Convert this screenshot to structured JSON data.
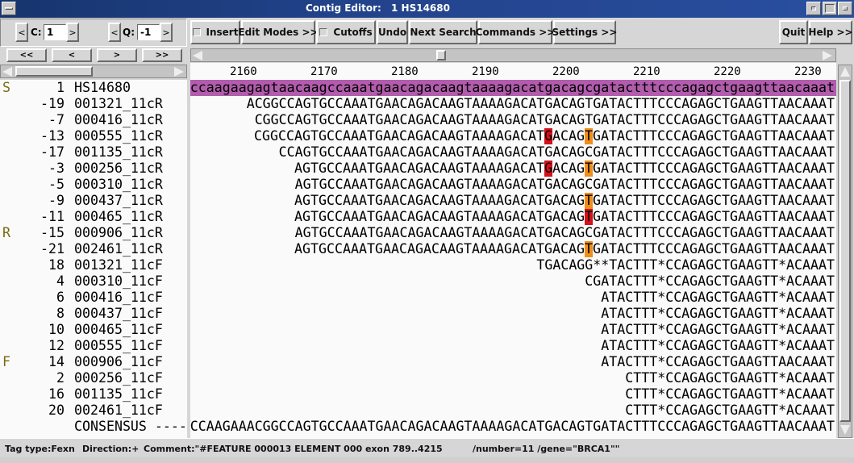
{
  "window": {
    "title": "Contig Editor:",
    "contig": "1 HS14680"
  },
  "toolbar": {
    "c_label": "C:",
    "c_value": "1",
    "q_label": "Q:",
    "q_value": "-1",
    "insert_label": "Insert",
    "edit_modes_label": "Edit Modes >>",
    "cutoffs_label": "Cutoffs",
    "undo_label": "Undo",
    "next_search_label": "Next Search",
    "commands_label": "Commands >>",
    "settings_label": "Settings >>",
    "quit_label": "Quit",
    "help_label": "Help >>",
    "left_arrow": "<",
    "right_arrow": ">"
  },
  "nav": {
    "first": "<<",
    "prev": "<",
    "next": ">",
    "last": ">>"
  },
  "ruler": {
    "ticks": [
      "2160",
      "2170",
      "2180",
      "2190",
      "2200",
      "2210",
      "2220",
      "2230"
    ]
  },
  "rows": [
    {
      "flag": "S",
      "num": "1",
      "name": "HS14680",
      "seq": "ccaagaagagtaacaagccaaatgaacagacaagtaaaagacatgacagcgatactttcccagagctgaagttaacaaat",
      "ref": true,
      "hl": []
    },
    {
      "flag": "",
      "num": "-19",
      "name": "001321_11cR",
      "seq": "ACGGCCAGTGCCAAATGAACAGACAAGTAAAAGACATGACAGTGATACTTTCCCAGAGCTGAAGTTAACAAAT",
      "hl": []
    },
    {
      "flag": "",
      "num": "-7",
      "name": "000416_11cR",
      "seq": "CGGCCAGTGCCAAATGAACAGACAAGTAAAAGACATGACAGTGATACTTTCCCAGAGCTGAAGTTAACAAAT",
      "hl": []
    },
    {
      "flag": "",
      "num": "-13",
      "name": "000555_11cR",
      "seq": "CGGCCAGTGCCAAATGAACAGACAAGTAAAAGACATGACAGTGATACTTTCCCAGAGCTGAAGTTAACAAAT",
      "hl": [
        {
          "from_end": 36,
          "color": "r"
        },
        {
          "from_end": 31,
          "color": "o"
        }
      ]
    },
    {
      "flag": "",
      "num": "-17",
      "name": "001135_11cR",
      "seq": "CCAGTGCCAAATGAACAGACAAGTAAAAGACATGACAGCGATACTTTCCCAGAGCTGAAGTTAACAAAT",
      "hl": []
    },
    {
      "flag": "",
      "num": "-3",
      "name": "000256_11cR",
      "seq": "AGTGCCAAATGAACAGACAAGTAAAAGACATGACAGTGATACTTTCCCAGAGCTGAAGTTAACAAAT",
      "hl": [
        {
          "from_end": 36,
          "color": "r"
        },
        {
          "from_end": 31,
          "color": "o"
        }
      ]
    },
    {
      "flag": "",
      "num": "-5",
      "name": "000310_11cR",
      "seq": "AGTGCCAAATGAACAGACAAGTAAAAGACATGACAGCGATACTTTCCCAGAGCTGAAGTTAACAAAT",
      "hl": []
    },
    {
      "flag": "",
      "num": "-9",
      "name": "000437_11cR",
      "seq": "AGTGCCAAATGAACAGACAAGTAAAAGACATGACAGTGATACTTTCCCAGAGCTGAAGTTAACAAAT",
      "hl": [
        {
          "from_end": 31,
          "color": "o"
        }
      ]
    },
    {
      "flag": "",
      "num": "-11",
      "name": "000465_11cR",
      "seq": "AGTGCCAAATGAACAGACAAGTAAAAGACATGACAGTGATACTTTCCCAGAGCTGAAGTTAACAAAT",
      "hl": [
        {
          "from_end": 31,
          "color": "r"
        }
      ]
    },
    {
      "flag": "R",
      "num": "-15",
      "name": "000906_11cR",
      "seq": "AGTGCCAAATGAACAGACAAGTAAAAGACATGACAGCGATACTTTCCCAGAGCTGAAGTTAACAAAT",
      "hl": []
    },
    {
      "flag": "",
      "num": "-21",
      "name": "002461_11cR",
      "seq": "AGTGCCAAATGAACAGACAAGTAAAAGACATGACAGTGATACTTTCCCAGAGCTGAAGTTAACAAAT",
      "hl": [
        {
          "from_end": 31,
          "color": "o"
        }
      ]
    },
    {
      "flag": "",
      "num": "18",
      "name": "001321_11cF",
      "seq": "TGACAGG**TACTTT*CCAGAGCTGAAGTT*ACAAAT",
      "hl": []
    },
    {
      "flag": "",
      "num": "4",
      "name": "000310_11cF",
      "seq": "CGATACTTT*CCAGAGCTGAAGTT*ACAAAT",
      "hl": []
    },
    {
      "flag": "",
      "num": "6",
      "name": "000416_11cF",
      "seq": "ATACTTT*CCAGAGCTGAAGTT*ACAAAT",
      "hl": []
    },
    {
      "flag": "",
      "num": "8",
      "name": "000437_11cF",
      "seq": "ATACTTT*CCAGAGCTGAAGTT*ACAAAT",
      "hl": []
    },
    {
      "flag": "",
      "num": "10",
      "name": "000465_11cF",
      "seq": "ATACTTT*CCAGAGCTGAAGTT*ACAAAT",
      "hl": []
    },
    {
      "flag": "",
      "num": "12",
      "name": "000555_11cF",
      "seq": "ATACTTT*CCAGAGCTGAAGTT*ACAAAT",
      "hl": []
    },
    {
      "flag": "F",
      "num": "14",
      "name": "000906_11cF",
      "seq": "ATACTTT*CCAGAGCTGAAGTTAACAAAT",
      "hl": []
    },
    {
      "flag": "",
      "num": "2",
      "name": "000256_11cF",
      "seq": "CTTT*CCAGAGCTGAAGTT*ACAAAT",
      "hl": []
    },
    {
      "flag": "",
      "num": "16",
      "name": "001135_11cF",
      "seq": "CTTT*CCAGAGCTGAAGTT*ACAAAT",
      "hl": []
    },
    {
      "flag": "",
      "num": "20",
      "name": "002461_11cF",
      "seq": "CTTT*CCAGAGCTGAAGTT*ACAAAT",
      "hl": []
    },
    {
      "flag": "",
      "num": "",
      "name": "CONSENSUS ----",
      "seq": "CCAAGAAACGGCCAGTGCCAAATGAACAGACAAGTAAAAGACATGACAGTGATACTTTCCCAGAGCTGAAGTTAACAAAT",
      "hl": []
    }
  ],
  "status": {
    "tag_type": "Tag type:Fexn",
    "direction": "Direction:+",
    "comment": "Comment:\"#FEATURE 000013 ELEMENT 000 exon 789..4215",
    "number_gene": "/number=11 /gene=\"BRCA1\"\""
  },
  "colors": {
    "reference_bg": "#b25cad",
    "highlight_red": "#d4101b",
    "highlight_orange": "#f08e1a"
  }
}
